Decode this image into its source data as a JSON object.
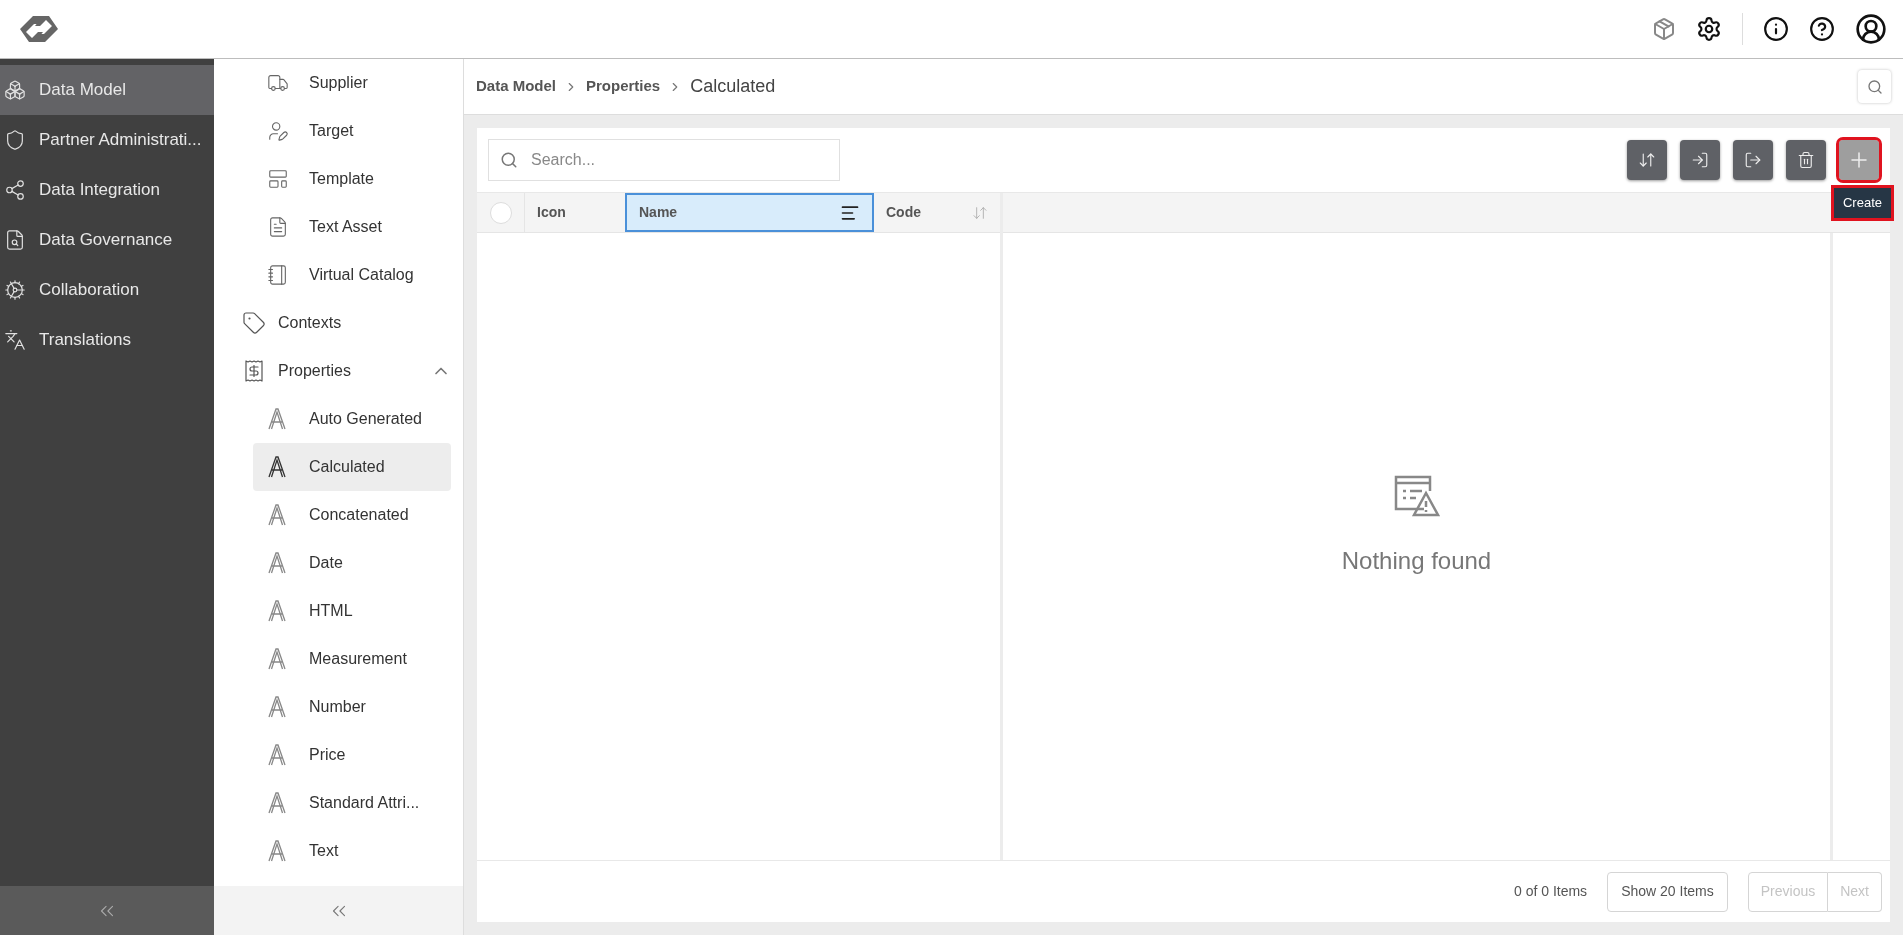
{
  "nav": {
    "items": [
      {
        "label": "Data Model",
        "selected": true
      },
      {
        "label": "Partner Administrati...",
        "selected": false
      },
      {
        "label": "Data Integration",
        "selected": false
      },
      {
        "label": "Data Governance",
        "selected": false
      },
      {
        "label": "Collaboration",
        "selected": false
      },
      {
        "label": "Translations",
        "selected": false
      }
    ]
  },
  "tree": {
    "scrolled_group_children": [
      {
        "label": "Supplier",
        "selected": false
      },
      {
        "label": "Target",
        "selected": false
      },
      {
        "label": "Template",
        "selected": false
      },
      {
        "label": "Text Asset",
        "selected": false
      },
      {
        "label": "Virtual Catalog",
        "selected": false
      }
    ],
    "items": [
      {
        "label": "Contexts",
        "selected": false
      },
      {
        "label": "Properties",
        "selected": false,
        "expanded": true,
        "children": [
          {
            "label": "Auto Generated",
            "selected": false
          },
          {
            "label": "Calculated",
            "selected": true
          },
          {
            "label": "Concatenated",
            "selected": false
          },
          {
            "label": "Date",
            "selected": false
          },
          {
            "label": "HTML",
            "selected": false
          },
          {
            "label": "Measurement",
            "selected": false
          },
          {
            "label": "Number",
            "selected": false
          },
          {
            "label": "Price",
            "selected": false
          },
          {
            "label": "Standard Attri...",
            "selected": false
          },
          {
            "label": "Text",
            "selected": false
          }
        ]
      }
    ]
  },
  "breadcrumb": [
    "Data Model",
    "Properties",
    "Calculated"
  ],
  "search": {
    "placeholder": "Search..."
  },
  "toolbar": {
    "buttons": [
      {
        "kind": "sync",
        "hovered": false
      },
      {
        "kind": "import",
        "hovered": false
      },
      {
        "kind": "export",
        "hovered": false
      },
      {
        "kind": "delete",
        "hovered": false
      },
      {
        "kind": "create",
        "hovered": true
      }
    ],
    "tooltip": "Create"
  },
  "table": {
    "select_all": {
      "checked": false
    },
    "columns": [
      {
        "label": "Icon",
        "selected": false,
        "sortable": false
      },
      {
        "label": "Name",
        "selected": true,
        "sortable": true
      },
      {
        "label": "Code",
        "selected": false,
        "sortable": true
      }
    ]
  },
  "empty_message": "Nothing found",
  "footer": {
    "count": "0 of 0 Items",
    "page_size": "Show 20 Items",
    "previous": {
      "label": "Previous",
      "disabled": true
    },
    "next": {
      "label": "Next",
      "disabled": true
    }
  }
}
